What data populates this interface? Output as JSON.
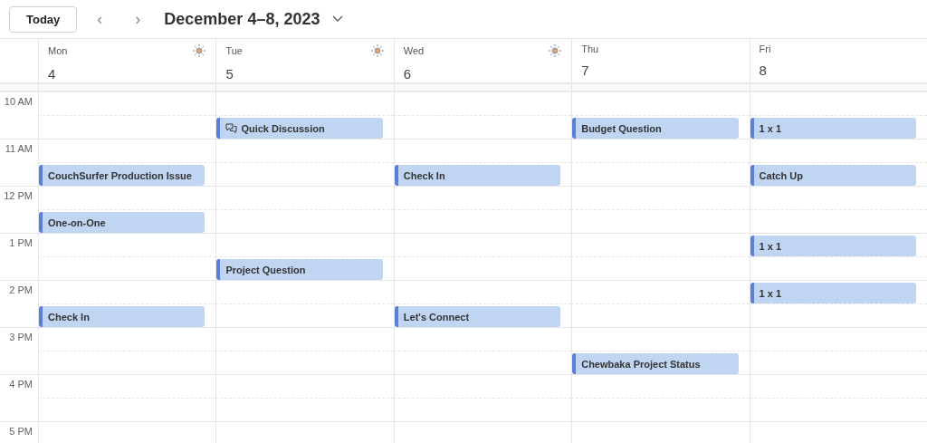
{
  "toolbar": {
    "today_button": "Today",
    "previous": "‹",
    "next": "›",
    "title": "December 4–8, 2023"
  },
  "days": [
    {
      "name": "Mon",
      "date": "4",
      "sunny": true
    },
    {
      "name": "Tue",
      "date": "5",
      "sunny": true
    },
    {
      "name": "Wed",
      "date": "6",
      "sunny": true
    },
    {
      "name": "Thu",
      "date": "7",
      "sunny": false
    },
    {
      "name": "Fri",
      "date": "8",
      "sunny": false
    }
  ],
  "rows": [
    {
      "time": "10 AM",
      "cells": [
        {
          "booked": false
        },
        {
          "booked": false
        },
        {
          "booked": false
        },
        {
          "booked": false
        },
        {
          "booked": false
        }
      ]
    },
    {
      "cells": [
        {
          "booked": false
        },
        {
          "booked": true,
          "title": "Quick Discussion",
          "kind": "chat"
        },
        {
          "booked": false
        },
        {
          "booked": true,
          "title": "Budget Question",
          "kind": "plain"
        },
        {
          "booked": true,
          "title": "1 x 1",
          "kind": "plain"
        }
      ]
    },
    {
      "time": "11 AM",
      "cells": [
        {
          "booked": false
        },
        {
          "booked": false
        },
        {
          "booked": false
        },
        {
          "booked": false
        },
        {
          "booked": false
        }
      ]
    },
    {
      "cells": [
        {
          "booked": true,
          "title": "CouchSurfer Production Issue",
          "kind": "plain"
        },
        {
          "booked": false
        },
        {
          "booked": true,
          "title": "Check In",
          "kind": "plain"
        },
        {
          "booked": false
        },
        {
          "booked": true,
          "title": "Catch Up",
          "kind": "plain"
        }
      ]
    },
    {
      "time": "12 PM",
      "cells": [
        {
          "booked": false
        },
        {
          "booked": false
        },
        {
          "booked": false
        },
        {
          "booked": false
        },
        {
          "booked": false
        }
      ]
    },
    {
      "cells": [
        {
          "booked": true,
          "title": "One-on-One",
          "kind": "plain"
        },
        {
          "booked": false
        },
        {
          "booked": false
        },
        {
          "booked": false
        },
        {
          "booked": false
        }
      ]
    },
    {
      "time": "1 PM",
      "cells": [
        {
          "booked": false
        },
        {
          "booked": false
        },
        {
          "booked": false
        },
        {
          "booked": false
        },
        {
          "booked": true,
          "title": "1 x 1",
          "kind": "plain"
        }
      ]
    },
    {
      "cells": [
        {
          "booked": false
        },
        {
          "booked": true,
          "title": "Project Question",
          "kind": "plain"
        },
        {
          "booked": false
        },
        {
          "booked": false
        },
        {
          "booked": false
        }
      ]
    },
    {
      "time": "2 PM",
      "cells": [
        {
          "booked": false
        },
        {
          "booked": false
        },
        {
          "booked": false
        },
        {
          "booked": false
        },
        {
          "booked": true,
          "title": "1 x 1",
          "kind": "plain"
        }
      ]
    },
    {
      "cells": [
        {
          "booked": true,
          "title": "Check In",
          "kind": "plain"
        },
        {
          "booked": false
        },
        {
          "booked": true,
          "title": "Let's Connect",
          "kind": "plain"
        },
        {
          "booked": false
        },
        {
          "booked": false
        }
      ]
    },
    {
      "time": "3 PM",
      "cells": [
        {
          "booked": false
        },
        {
          "booked": false
        },
        {
          "booked": false
        },
        {
          "booked": false
        },
        {
          "booked": false
        }
      ]
    },
    {
      "cells": [
        {
          "booked": false
        },
        {
          "booked": false
        },
        {
          "booked": false
        },
        {
          "booked": true,
          "title": "Chewbaka Project Status",
          "kind": "plain"
        },
        {
          "booked": false
        }
      ]
    },
    {
      "time": "4 PM",
      "cells": [
        {
          "booked": false
        },
        {
          "booked": false
        },
        {
          "booked": false
        },
        {
          "booked": false
        },
        {
          "booked": false
        }
      ]
    },
    {
      "cells": [
        {
          "booked": false
        },
        {
          "booked": false
        },
        {
          "booked": false
        },
        {
          "booked": false
        },
        {
          "booked": false
        }
      ]
    },
    {
      "time": "5 PM",
      "cells": [
        {
          "booked": false
        },
        {
          "booked": false
        },
        {
          "booked": false
        },
        {
          "booked": false
        },
        {
          "booked": false
        }
      ]
    }
  ]
}
